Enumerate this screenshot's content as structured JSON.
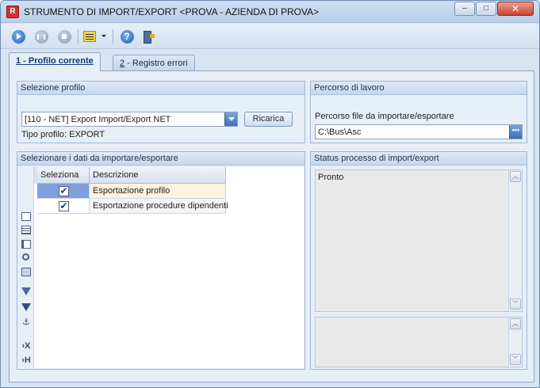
{
  "window": {
    "title": "STRUMENTO DI IMPORT/EXPORT <PROVA - AZIENDA DI PROVA>",
    "app_icon_letter": "R",
    "minimize_glyph": "–",
    "maximize_glyph": "□",
    "close_glyph": "✕"
  },
  "toolbar": {
    "buttons": [
      "play-icon",
      "pause-icon",
      "stop-icon",
      "list-dropdown-icon",
      "help-icon",
      "exit-icon"
    ],
    "help_glyph": "?"
  },
  "tabs": [
    {
      "number": "1",
      "label": " - Profilo corrente",
      "active": true
    },
    {
      "number": "2",
      "label": " - Registro errori",
      "active": false
    }
  ],
  "profile": {
    "header": "Selezione profilo",
    "combo_value": "[110 - NET] Export Import/Export NET",
    "reload_label": "Ricarica",
    "type_label": "Tipo profilo: EXPORT"
  },
  "work_path": {
    "header": "Percorso di lavoro",
    "field_label": "Percorso file da importare/esportare",
    "field_value": "C:\\Bus\\Asc",
    "browse_glyph": "•••"
  },
  "data_select": {
    "header": "Selezionare i dati da importare/esportare",
    "columns": [
      "Seleziona",
      "Descrizione"
    ],
    "rows": [
      {
        "checked": "✔",
        "description": "Esportazione profilo"
      },
      {
        "checked": "✔",
        "description": "Esportazione procedure dipendenti"
      }
    ],
    "side_glyphs": {
      "anchor": "⚓",
      "remove": "›X",
      "pin": "›H"
    }
  },
  "status": {
    "header": "Status processo di import/export",
    "text": "Pronto",
    "scroll_up": "︿",
    "scroll_down": "﹀"
  }
}
